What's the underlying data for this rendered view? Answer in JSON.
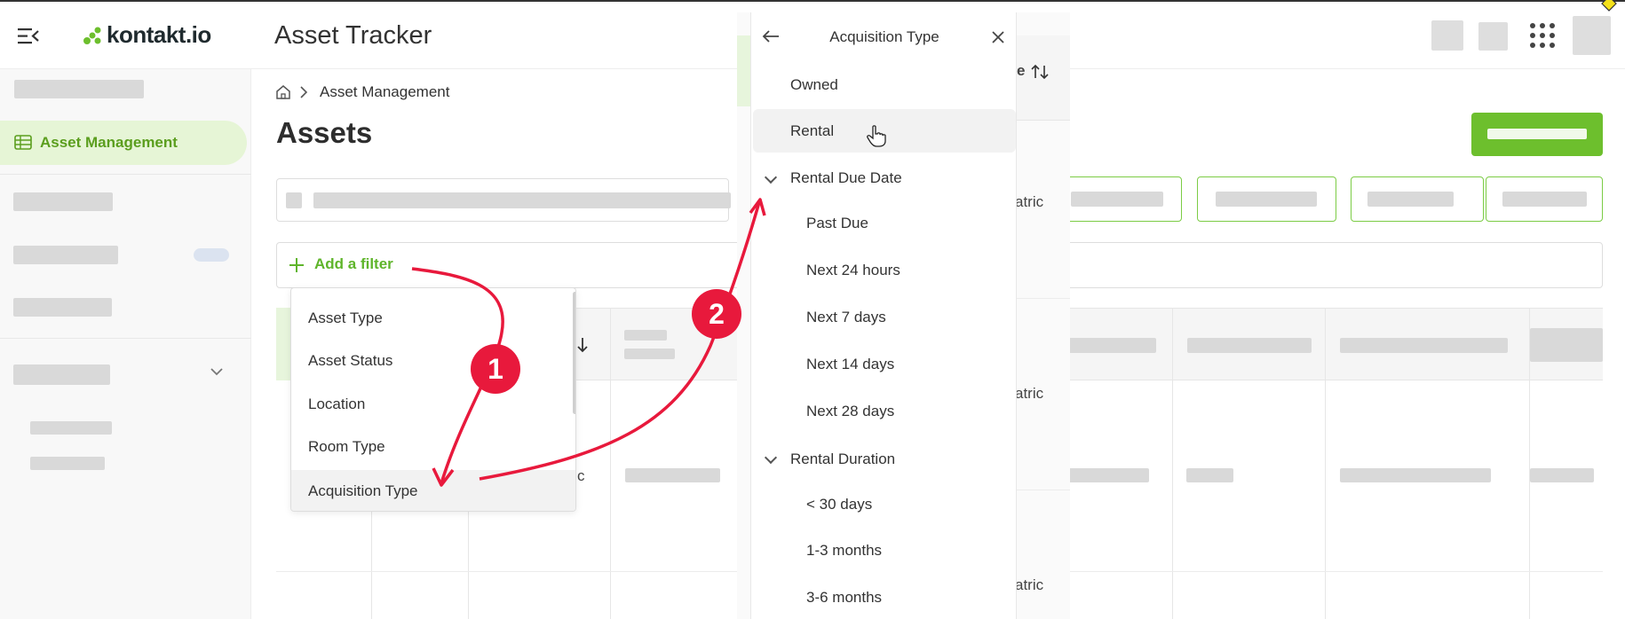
{
  "app": {
    "logo_text": "kontakt.io",
    "title": "Asset Tracker"
  },
  "sidebar": {
    "active_item": "Asset Management"
  },
  "breadcrumb": {
    "current": "Asset Management"
  },
  "page": {
    "title": "Assets"
  },
  "filter": {
    "add_label": "Add a filter"
  },
  "filter_menu": {
    "items": [
      "Asset Type",
      "Asset Status",
      "Location",
      "Room Type",
      "Acquisition Type"
    ]
  },
  "acquisition_panel": {
    "title": "Acquisition Type",
    "options": [
      "Owned",
      "Rental"
    ],
    "groups": [
      {
        "label": "Rental Due Date",
        "items": [
          "Past Due",
          "Next 24 hours",
          "Next 7 days",
          "Next 14 days",
          "Next 28 days"
        ]
      },
      {
        "label": "Rental Duration",
        "items": [
          "< 30 days",
          "1-3 months",
          "3-6 months"
        ]
      }
    ]
  },
  "table": {
    "partial_header": "e",
    "partial_cells": [
      "atric",
      "atric",
      "atric"
    ],
    "partial_cell_c": "c"
  },
  "annotations": {
    "step1": "1",
    "step2": "2"
  },
  "colors": {
    "accent": "#6dbf2d",
    "annotation": "#e8193c"
  }
}
